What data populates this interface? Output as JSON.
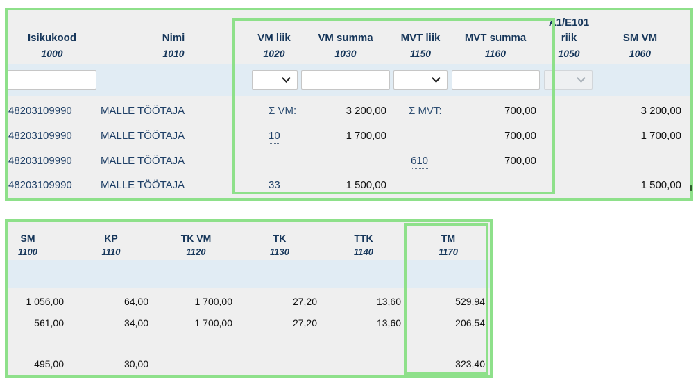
{
  "colors": {
    "panel_bg": "#efefef",
    "filter_band": "#e1ecf4",
    "header_text": "#16365a",
    "link_text": "#1e3f66",
    "highlight": "#8ee08a"
  },
  "top_table": {
    "columns": {
      "isikukood": {
        "label": "Isikukood",
        "code": "1000"
      },
      "nimi": {
        "label": "Nimi",
        "code": "1010"
      },
      "vm_liik": {
        "label": "VM liik",
        "code": "1020"
      },
      "vm_summa": {
        "label": "VM summa",
        "code": "1030"
      },
      "mvt_liik": {
        "label": "MVT liik",
        "code": "1150"
      },
      "mvt_summa": {
        "label": "MVT summa",
        "code": "1160"
      },
      "riik": {
        "pre_label": "A1/E101",
        "label": "riik",
        "code": "1050"
      },
      "sm_vm": {
        "label": "SM VM",
        "code": "1060"
      }
    },
    "summary": {
      "isikukood": "48203109990",
      "nimi": "MALLE TÖÖTAJA",
      "vm_sigma": "Σ VM:",
      "vm_summa": "3 200,00",
      "mvt_sigma": "Σ MVT:",
      "mvt_summa": "700,00",
      "sm_vm": "3 200,00"
    },
    "rows": [
      {
        "isikukood": "48203109990",
        "nimi": "MALLE TÖÖTAJA",
        "vm_liik": "10",
        "vm_summa": "1 700,00",
        "mvt_liik": "",
        "mvt_summa": "700,00",
        "sm_vm": "1 700,00"
      },
      {
        "isikukood": "48203109990",
        "nimi": "MALLE TÖÖTAJA",
        "vm_liik": "",
        "vm_summa": "",
        "mvt_liik": "610",
        "mvt_summa": "700,00",
        "sm_vm": ""
      },
      {
        "isikukood": "48203109990",
        "nimi": "MALLE TÖÖTAJA",
        "vm_liik": "33",
        "vm_summa": "1 500,00",
        "mvt_liik": "",
        "mvt_summa": "",
        "sm_vm": "1 500,00"
      }
    ]
  },
  "bottom_table": {
    "columns": {
      "sm": {
        "label": "SM",
        "code": "1100"
      },
      "kp": {
        "label": "KP",
        "code": "1110"
      },
      "tk_vm": {
        "label": "TK VM",
        "code": "1120"
      },
      "tk": {
        "label": "TK",
        "code": "1130"
      },
      "ttk": {
        "label": "TTK",
        "code": "1140"
      },
      "tm": {
        "label": "TM",
        "code": "1170"
      }
    },
    "rows": [
      {
        "sm": "1 056,00",
        "kp": "64,00",
        "tk_vm": "1 700,00",
        "tk": "27,20",
        "ttk": "13,60",
        "tm": "529,94"
      },
      {
        "sm": "561,00",
        "kp": "34,00",
        "tk_vm": "1 700,00",
        "tk": "27,20",
        "ttk": "13,60",
        "tm": "206,54"
      },
      {
        "sm": "",
        "kp": "",
        "tk_vm": "",
        "tk": "",
        "ttk": "",
        "tm": ""
      },
      {
        "sm": "495,00",
        "kp": "30,00",
        "tk_vm": "",
        "tk": "",
        "ttk": "",
        "tm": "323,40"
      }
    ]
  }
}
